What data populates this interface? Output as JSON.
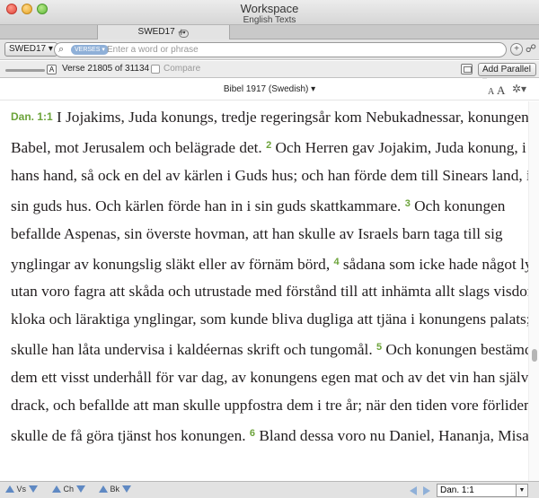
{
  "window": {
    "title": "Workspace",
    "subtitle": "English Texts"
  },
  "tabs": [
    {
      "label": "SWED17",
      "arrow": "▾"
    }
  ],
  "tab_add": "+",
  "toolbar": {
    "version_button": "SWED17 ▾",
    "search_mode_badge": "VERSES ▾",
    "search_placeholder": "Enter a word or phrase",
    "search_value": "",
    "add_icon": "+",
    "search_glyph": "⌕",
    "share_glyph": "☍"
  },
  "status": {
    "slider_label": "A",
    "verse_info": "Verse 21805 of 31134",
    "compare_label": "Compare",
    "add_parallel_label": "Add Parallel ▾"
  },
  "version_bar": {
    "version_label": "Bibel 1917 (Swedish) ▾",
    "font_small": "A",
    "font_large": "A",
    "gear": "✲▾"
  },
  "passage": {
    "reference": "Dan. 1:1",
    "verse_start": 1,
    "verse_end": 6,
    "lines": [
      [
        {
          "t": "ref",
          "v": "Dan. 1:1"
        },
        {
          "t": "txt",
          "v": " I Jojakims, Juda konungs, tredje regeringsår kom Nebukadnessar, konungen i"
        }
      ],
      [
        {
          "t": "txt",
          "v": "Babel, mot Jerusalem och belägrade det. "
        },
        {
          "t": "num",
          "v": "2"
        },
        {
          "t": "txt",
          "v": " Och Herren gav Jojakim, Juda konung, i"
        }
      ],
      [
        {
          "t": "txt",
          "v": "hans hand, så ock en del av kärlen i Guds hus; och han förde dem till Sinears land, in i"
        }
      ],
      [
        {
          "t": "txt",
          "v": "sin guds hus. Och kärlen förde han in i sin guds skattkammare. "
        },
        {
          "t": "num",
          "v": "3"
        },
        {
          "t": "txt",
          "v": " Och konungen"
        }
      ],
      [
        {
          "t": "txt",
          "v": "befallde Aspenas, sin överste hovman, att han skulle av Israels barn taga till sig"
        }
      ],
      [
        {
          "t": "txt",
          "v": "ynglingar av konungslig släkt eller av förnäm börd, "
        },
        {
          "t": "num",
          "v": "4"
        },
        {
          "t": "txt",
          "v": " sådana som icke hade något lyte,"
        }
      ],
      [
        {
          "t": "txt",
          "v": "utan voro fagra att skåda och utrustade med förstånd till att inhämta allt slags visdom,"
        }
      ],
      [
        {
          "t": "txt",
          "v": "kloka och läraktiga ynglingar, som kunde bliva dugliga att tjäna i konungens palats; dem"
        }
      ],
      [
        {
          "t": "txt",
          "v": "skulle han låta undervisa i kaldéernas skrift och tungomål. "
        },
        {
          "t": "num",
          "v": "5"
        },
        {
          "t": "txt",
          "v": " Och konungen bestämde åt"
        }
      ],
      [
        {
          "t": "txt",
          "v": "dem ett visst underhåll för var dag, av konungens egen mat och av det vin han själv"
        }
      ],
      [
        {
          "t": "txt",
          "v": "drack, och befallde att man skulle uppfostra dem i tre år; när den tiden vore förliden,"
        }
      ],
      [
        {
          "t": "txt",
          "v": "skulle de få göra tjänst hos konungen. "
        },
        {
          "t": "num",
          "v": "6"
        },
        {
          "t": "txt",
          "v": " Bland dessa voro nu Daniel, Hananja, Misael"
        }
      ]
    ]
  },
  "bottom": {
    "verse_nav": "Vs",
    "chapter_nav": "Ch",
    "book_nav": "Bk",
    "reference_value": "Dan. 1:1"
  },
  "colors": {
    "verse_number": "#6ca33a",
    "nav_arrow": "#5f89c3"
  }
}
